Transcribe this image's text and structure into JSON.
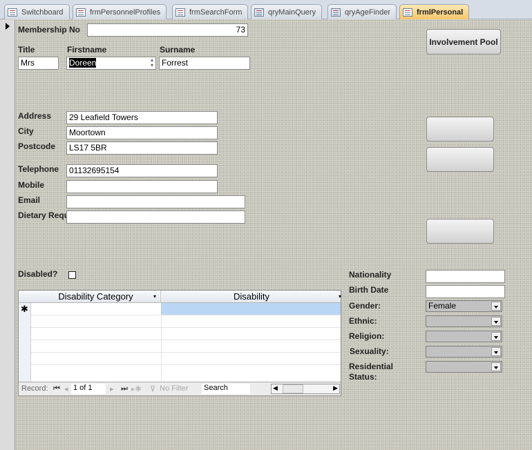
{
  "tabs": [
    {
      "label": "Switchboard",
      "icon": "form-icon"
    },
    {
      "label": "frmPersonnelProfiles",
      "icon": "form-icon"
    },
    {
      "label": "frmSearchForm",
      "icon": "form-icon"
    },
    {
      "label": "qryMainQuery",
      "icon": "query-icon"
    },
    {
      "label": "qryAgeFinder",
      "icon": "query-icon"
    },
    {
      "label": "frmlPersonal",
      "icon": "form-icon",
      "active": true
    }
  ],
  "form": {
    "membership_label": "Membership No",
    "membership_value": "73",
    "title_label": "Title",
    "title_value": "Mrs",
    "firstname_label": "Firstname",
    "firstname_value": "Doreen",
    "surname_label": "Surname",
    "surname_value": "Forrest",
    "involvement_button": "Involvement Pool",
    "address_label": "Address",
    "address_value": "29 Leafield Towers",
    "city_label": "City",
    "city_value": "Moortown",
    "postcode_label": "Postcode",
    "postcode_value": "LS17 5BR",
    "telephone_label": "Telephone",
    "telephone_value": "01132695154",
    "mobile_label": "Mobile",
    "mobile_value": "",
    "email_label": "Email",
    "email_value": "",
    "dietary_label": "Dietary Requ",
    "dietary_value": "",
    "disabled_label": "Disabled?",
    "disabled_checked": false
  },
  "subform": {
    "columns": [
      "Disability Category",
      "Disability"
    ],
    "new_row_marker": "✱",
    "nav": {
      "record_label": "Record:",
      "position": "1 of 1",
      "filter": "No Filter",
      "search": "Search"
    }
  },
  "details": {
    "nationality_label": "Nationality",
    "nationality_value": "",
    "birthdate_label": "Birth Date",
    "birthdate_value": "",
    "gender_label": "Gender:",
    "gender_value": "Female",
    "ethnic_label": "Ethnic:",
    "ethnic_value": "",
    "religion_label": "Religion:",
    "religion_value": "",
    "sexuality_label": "Sexuality:",
    "sexuality_value": "",
    "residential_label": "Residential Status:",
    "residential_value": ""
  }
}
